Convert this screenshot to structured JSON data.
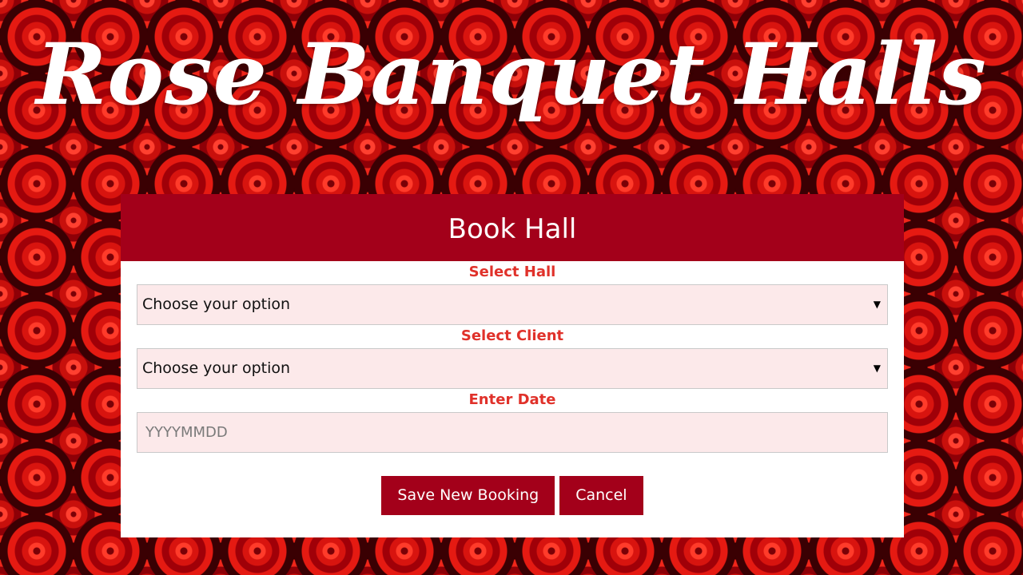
{
  "site": {
    "title": "Rose Banquet Halls"
  },
  "form": {
    "heading": "Book Hall",
    "hall": {
      "label": "Select Hall",
      "selected": "Choose your option"
    },
    "client": {
      "label": "Select Client",
      "selected": "Choose your option"
    },
    "date": {
      "label": "Enter Date",
      "placeholder": "YYYYMMDD",
      "value": ""
    },
    "buttons": {
      "save_label": "Save New Booking",
      "cancel_label": "Cancel"
    }
  },
  "icons": {
    "dropdown_arrow": "▼"
  },
  "colors": {
    "accent": "#a3001a",
    "label": "#e0312a",
    "input_background": "#fce9ea"
  }
}
